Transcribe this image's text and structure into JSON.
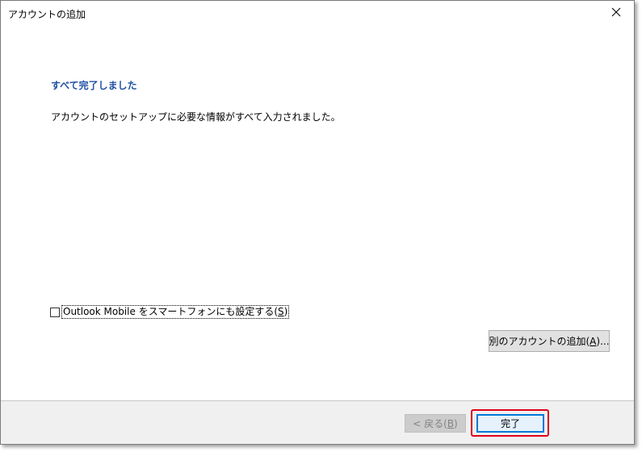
{
  "window": {
    "title": "アカウントの追加"
  },
  "content": {
    "heading": "すべて完了しました",
    "description": "アカウントのセットアップに必要な情報がすべて入力されました。",
    "mobile_checkbox": {
      "label_prefix": "Outlook Mobile をスマートフォンにも設定する(",
      "label_accel": "S",
      "label_suffix": ")",
      "checked": false
    },
    "add_account_button": {
      "label_prefix": "別のアカウントの追加(",
      "label_accel": "A",
      "label_suffix": ")..."
    }
  },
  "footer": {
    "back_button": {
      "label_prefix": "< 戻る(",
      "label_accel": "B",
      "label_suffix": ")",
      "enabled": false
    },
    "finish_button": {
      "label": "完了"
    }
  },
  "colors": {
    "heading": "#1f4fa3",
    "highlight": "#e0001a",
    "focus_border": "#0078d7"
  },
  "icons": {
    "close": "close-icon"
  }
}
